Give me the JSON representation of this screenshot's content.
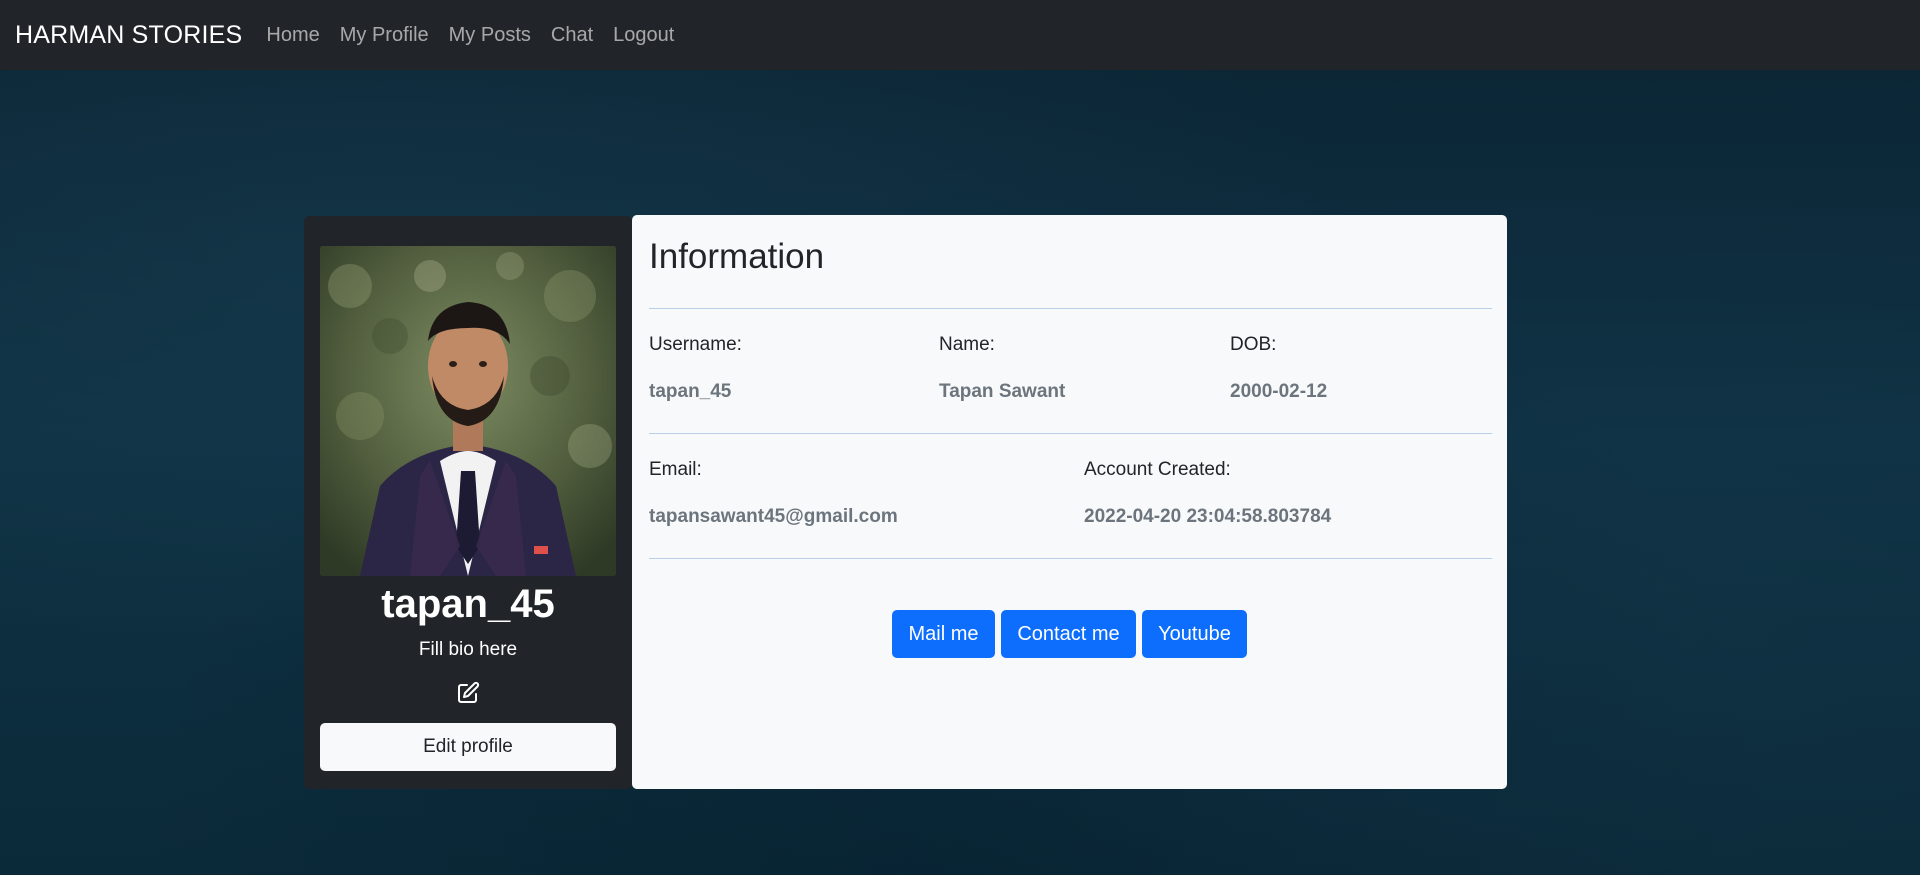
{
  "navbar": {
    "brand": "HARMAN STORIES",
    "links": [
      "Home",
      "My Profile",
      "My Posts",
      "Chat",
      "Logout"
    ]
  },
  "profile": {
    "username": "tapan_45",
    "bio": "Fill bio here",
    "edit_icon": "edit-pencil-square-icon",
    "edit_button": "Edit profile"
  },
  "info": {
    "title": "Information",
    "username_label": "Username:",
    "username_value": "tapan_45",
    "name_label": "Name:",
    "name_value": "Tapan Sawant",
    "dob_label": "DOB:",
    "dob_value": "2000-02-12",
    "email_label": "Email:",
    "email_value": "tapansawant45@gmail.com",
    "created_label": "Account Created:",
    "created_value": "2022-04-20 23:04:58.803784"
  },
  "actions": {
    "mail": "Mail me",
    "contact": "Contact me",
    "youtube": "Youtube"
  },
  "colors": {
    "navbar": "#212529",
    "primary": "#0d6efd",
    "panel": "#f8f9fa"
  }
}
